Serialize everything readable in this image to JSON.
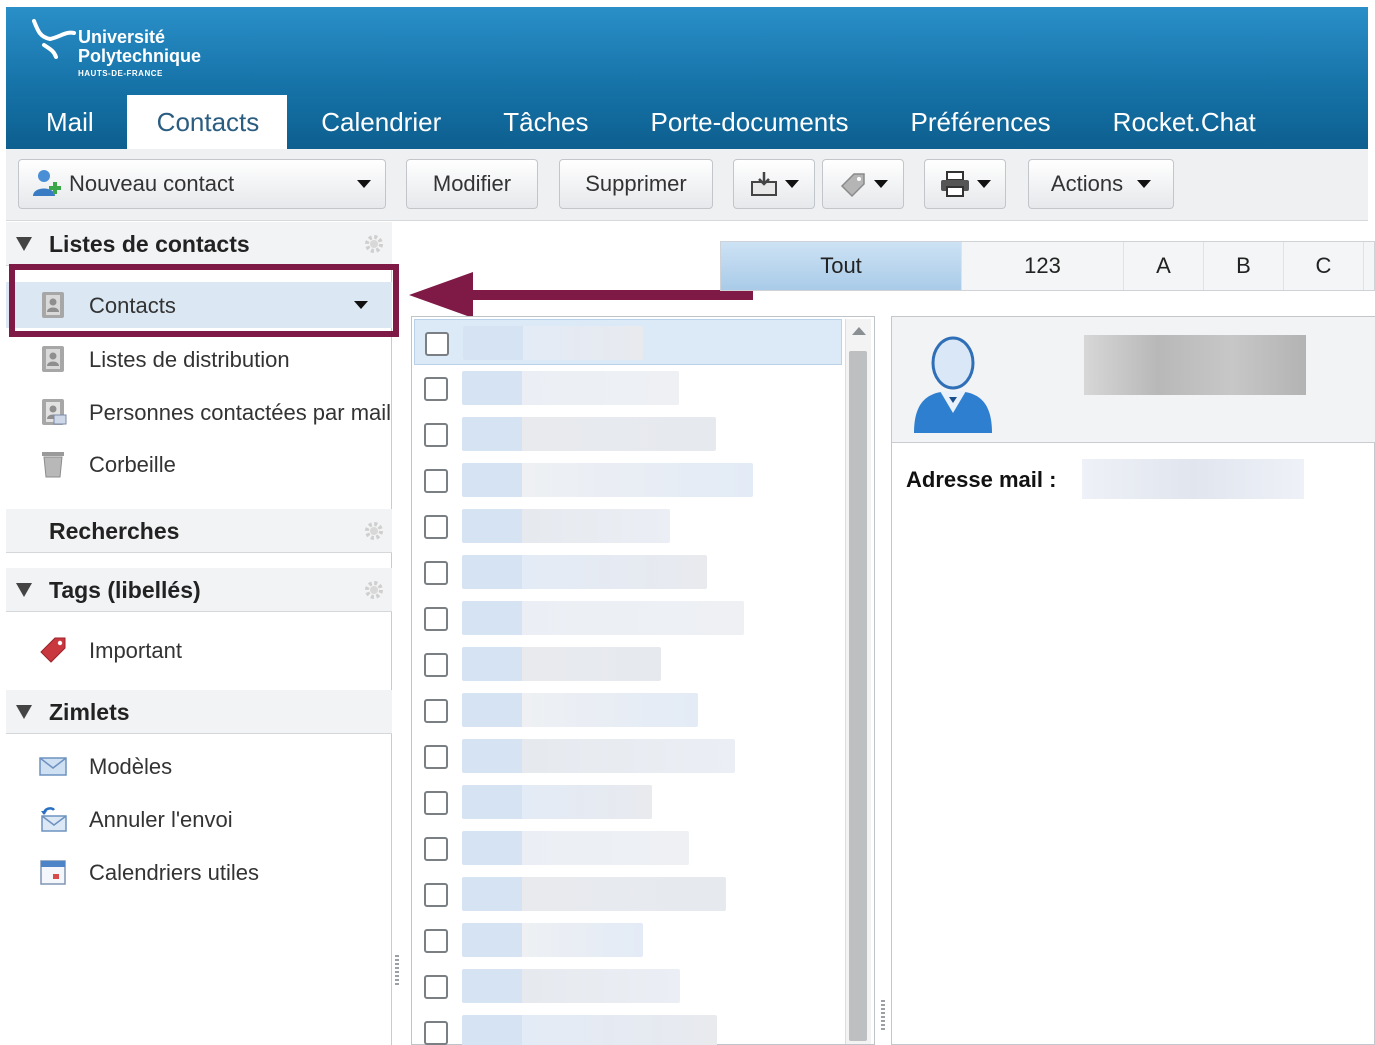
{
  "header": {
    "logo_line1": "Université",
    "logo_line2": "Polytechnique",
    "logo_sub": "HAUTS-DE-FRANCE",
    "tabs": [
      {
        "label": "Mail"
      },
      {
        "label": "Contacts"
      },
      {
        "label": "Calendrier"
      },
      {
        "label": "Tâches"
      },
      {
        "label": "Porte-documents"
      },
      {
        "label": "Préférences"
      },
      {
        "label": "Rocket.Chat"
      }
    ],
    "active_tab": "Contacts"
  },
  "toolbar": {
    "new_contact": "Nouveau contact",
    "edit": "Modifier",
    "delete": "Supprimer",
    "actions": "Actions"
  },
  "sidebar": {
    "contact_lists_title": "Listes de contacts",
    "contact_lists": [
      {
        "label": "Contacts",
        "icon": "address-book-icon"
      },
      {
        "label": "Listes de distribution",
        "icon": "address-book-icon"
      },
      {
        "label": "Personnes contactées par mail",
        "icon": "contacted-people-icon"
      },
      {
        "label": "Corbeille",
        "icon": "trash-icon"
      }
    ],
    "searches_title": "Recherches",
    "tags_title": "Tags (libellés)",
    "tags": [
      {
        "label": "Important",
        "icon": "tag-icon"
      }
    ],
    "zimlets_title": "Zimlets",
    "zimlets": [
      {
        "label": "Modèles",
        "icon": "envelope-icon"
      },
      {
        "label": "Annuler l'envoi",
        "icon": "undo-send-icon"
      },
      {
        "label": "Calendriers utiles",
        "icon": "calendar-icon"
      }
    ]
  },
  "alphabet": [
    "Tout",
    "123",
    "A",
    "B",
    "C"
  ],
  "detail": {
    "email_label": "Adresse mail :"
  },
  "colors": {
    "header_blue": "#1673a8",
    "highlight": "#7f1a47",
    "selected_row": "#dbe7f3"
  }
}
